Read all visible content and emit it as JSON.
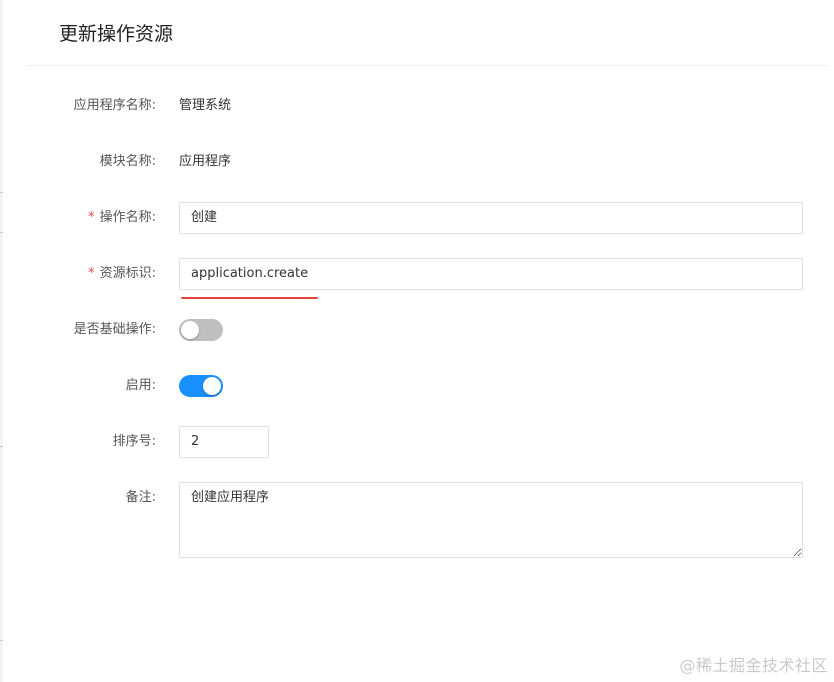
{
  "dialog": {
    "title": "更新操作资源"
  },
  "form": {
    "app_name": {
      "label": "应用程序名称:",
      "value": "管理系统"
    },
    "module_name": {
      "label": "模块名称:",
      "value": "应用程序"
    },
    "operation_name": {
      "required_mark": "*",
      "label": "操作名称:",
      "value": "创建"
    },
    "resource_key": {
      "required_mark": "*",
      "label": "资源标识:",
      "value": "application.create"
    },
    "is_basic": {
      "label": "是否基础操作:",
      "checked": false
    },
    "enabled": {
      "label": "启用:",
      "checked": true
    },
    "sort_order": {
      "label": "排序号:",
      "value": "2"
    },
    "remark": {
      "label": "备注:",
      "value": "创建应用程序"
    }
  },
  "watermark": "@稀土掘金技术社区",
  "colors": {
    "switch_on": "#1890ff",
    "switch_off": "#bfbfbf",
    "required": "#f04b4b",
    "underline": "#e0443c"
  }
}
